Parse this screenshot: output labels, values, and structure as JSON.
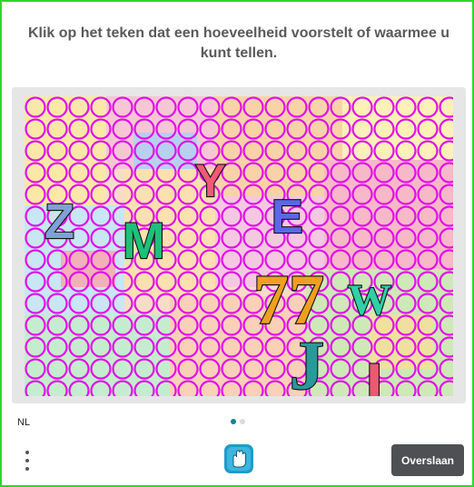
{
  "challenge": {
    "prompt": "Klik op het teken dat een hoeveelheid voorstelt of waarmee u kunt tellen.",
    "characters": [
      "Z",
      "M",
      "Y",
      "E",
      "77",
      "W",
      "J",
      "I"
    ]
  },
  "footer": {
    "language": "NL",
    "skip_label": "Overslaan",
    "page_indicator": {
      "current": 1,
      "total": 2
    }
  },
  "colors": {
    "border": "#2bd82b",
    "button": "#4f5053",
    "dot_active": "#1a7f90",
    "circle_grid": "#e010e8"
  },
  "icons": {
    "menu": "more-vertical-icon",
    "logo": "hcaptcha-hand-icon"
  }
}
